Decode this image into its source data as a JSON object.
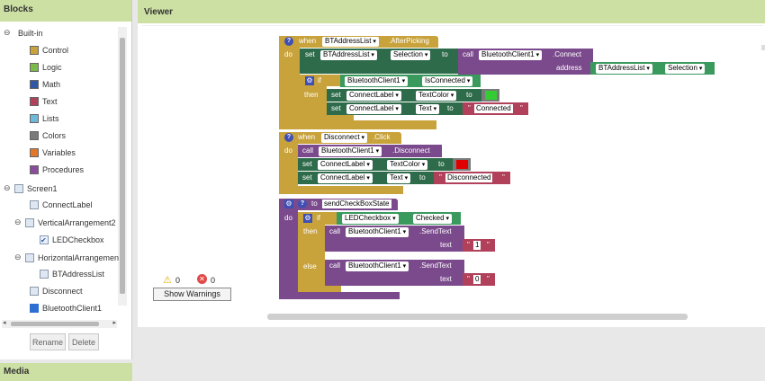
{
  "blocks_panel": {
    "title": "Blocks",
    "builtin": {
      "toggle": "⊖",
      "label": "Built-in"
    },
    "builtin_items": [
      {
        "label": "Control",
        "color": "#c8a23a"
      },
      {
        "label": "Logic",
        "color": "#7cba4a"
      },
      {
        "label": "Math",
        "color": "#3057a5"
      },
      {
        "label": "Text",
        "color": "#b1405a"
      },
      {
        "label": "Lists",
        "color": "#6fb9d8"
      },
      {
        "label": "Colors",
        "color": "#7a7a7a"
      },
      {
        "label": "Variables",
        "color": "#e0772b"
      },
      {
        "label": "Procedures",
        "color": "#8a4d9b"
      }
    ],
    "components": [
      {
        "toggle": "⊖",
        "label": "Screen1",
        "icon": "screen-icon"
      },
      {
        "toggle": "",
        "label": "ConnectLabel",
        "icon": "label-icon"
      },
      {
        "toggle": "⊖",
        "label": "VerticalArrangement2",
        "icon": "arrangement-icon"
      },
      {
        "toggle": "",
        "label": "LEDCheckbox",
        "icon": "checkbox-icon"
      },
      {
        "toggle": "⊖",
        "label": "HorizontalArrangemen",
        "icon": "arrangement-icon"
      },
      {
        "toggle": "",
        "label": "BTAddressList",
        "icon": "listpicker-icon"
      },
      {
        "toggle": "",
        "label": "Disconnect",
        "icon": "button-icon"
      },
      {
        "toggle": "",
        "label": "BluetoothClient1",
        "icon": "bluetooth-icon"
      }
    ],
    "rename": "Rename",
    "delete": "Delete"
  },
  "media_panel": {
    "title": "Media"
  },
  "viewer": {
    "title": "Viewer",
    "warnings": {
      "warn_count": "0",
      "error_count": "0",
      "show_warnings": "Show Warnings"
    }
  },
  "block1": {
    "when": "when",
    "component": "BTAddressList",
    "event": ".AfterPicking",
    "do": "do",
    "set": "set",
    "set_component": "BTAddressList",
    "set_prop": "Selection",
    "to": "to",
    "call": "call",
    "call_component": "BluetoothClient1",
    "call_method": ".Connect",
    "address": "address",
    "addr_component": "BTAddressList",
    "addr_prop": "Selection",
    "if": "if",
    "if_component": "BluetoothClient1",
    "if_prop": "IsConnected",
    "then": "then",
    "s1_component": "ConnectLabel",
    "s1_prop": "TextColor",
    "s2_component": "ConnectLabel",
    "s2_prop": "Text",
    "s2_value": "Connected"
  },
  "block2": {
    "when": "when",
    "component": "Disconnect",
    "event": ".Click",
    "do": "do",
    "call": "call",
    "call_component": "BluetoothClient1",
    "call_method": ".Disconnect",
    "set": "set",
    "to": "to",
    "s1_component": "ConnectLabel",
    "s1_prop": "TextColor",
    "s2_component": "ConnectLabel",
    "s2_prop": "Text",
    "s2_value": "Disconnected"
  },
  "block3": {
    "to": "to",
    "proc_name": "sendCheckBoxState",
    "do": "do",
    "if": "if",
    "cond_component": "LEDCheckbox",
    "cond_prop": "Checked",
    "then": "then",
    "else": "else",
    "call": "call",
    "call_component": "BluetoothClient1",
    "call_method": ".SendText",
    "text": "text",
    "then_value": "1",
    "else_value": "0"
  },
  "colors": {
    "control": "#c8a23a",
    "component_set": "#2e6b4a",
    "component_call": "#7b4a8c",
    "text": "#b1405a",
    "procedure": "#7b4a8c",
    "green_swatch": "#33cc33",
    "red_swatch": "#e00000",
    "component_get": "#3a9a5e"
  }
}
